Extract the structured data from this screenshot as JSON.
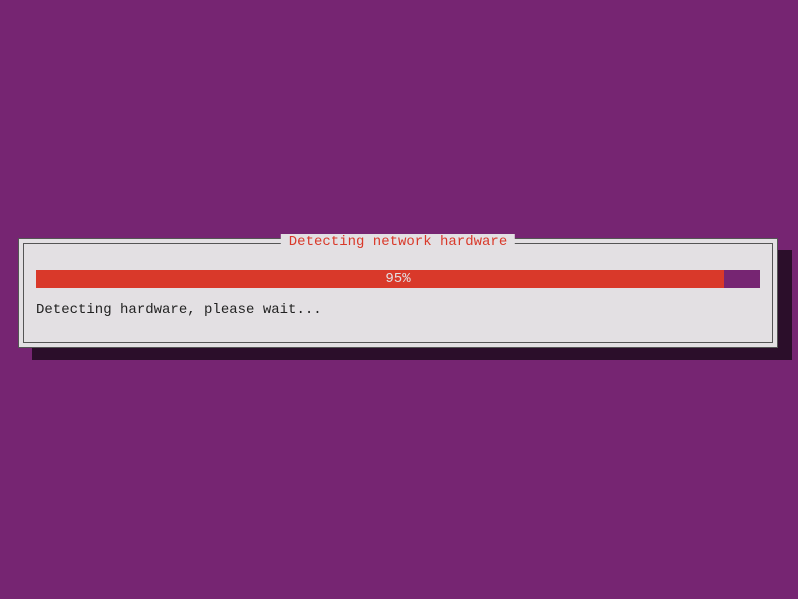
{
  "dialog": {
    "title": "Detecting network hardware",
    "progress_percent": 95,
    "progress_label": "95%",
    "status_text": "Detecting hardware, please wait..."
  },
  "colors": {
    "background": "#762572",
    "dialog_bg": "#e3e0e3",
    "title_color": "#d9392a",
    "progress_fill": "#d9392a",
    "progress_bg": "#762572"
  }
}
